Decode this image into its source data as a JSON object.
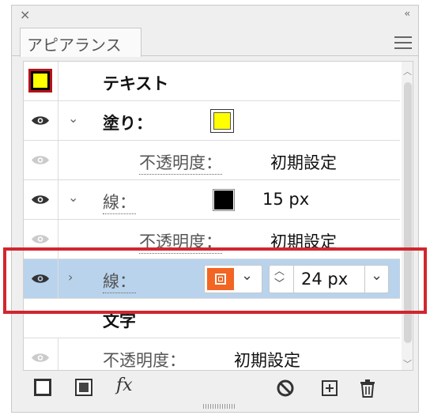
{
  "panel": {
    "tab_title": "アピアランス",
    "close_glyph": "×",
    "collapse_glyph": "‹‹"
  },
  "rows": {
    "header": {
      "label": "テキスト"
    },
    "fill": {
      "label": "塗り：",
      "swatch_color": "#ffff00"
    },
    "fill_opacity": {
      "label": "不透明度：",
      "value": "初期設定"
    },
    "stroke1": {
      "label": "線：",
      "weight": "15 px",
      "swatch_color": "#000000"
    },
    "stroke1_opacity": {
      "label": "不透明度：",
      "value": "初期設定"
    },
    "stroke2": {
      "label": "線：",
      "weight_value": "24 px",
      "swatch_color": "#f26522"
    },
    "characters": {
      "label": "文字"
    },
    "char_opacity": {
      "label": "不透明度：",
      "value": "初期設定"
    }
  },
  "colors": {
    "selection": "#b9d3ec",
    "highlight_frame": "#d0262f",
    "header_swatch_fill": "#ffff00",
    "header_swatch_border": "#b5121b"
  },
  "icons": [
    "close-icon",
    "collapse-icon",
    "panel-menu-icon",
    "eye-icon",
    "chevron-down-icon",
    "chevron-right-icon",
    "stroke-swatch-icon",
    "stepper-icon",
    "new-stroke-icon",
    "new-fill-icon",
    "fx-icon",
    "clear-appearance-icon",
    "duplicate-item-icon",
    "trash-icon"
  ],
  "bottom": {
    "fx_label": "fx"
  }
}
